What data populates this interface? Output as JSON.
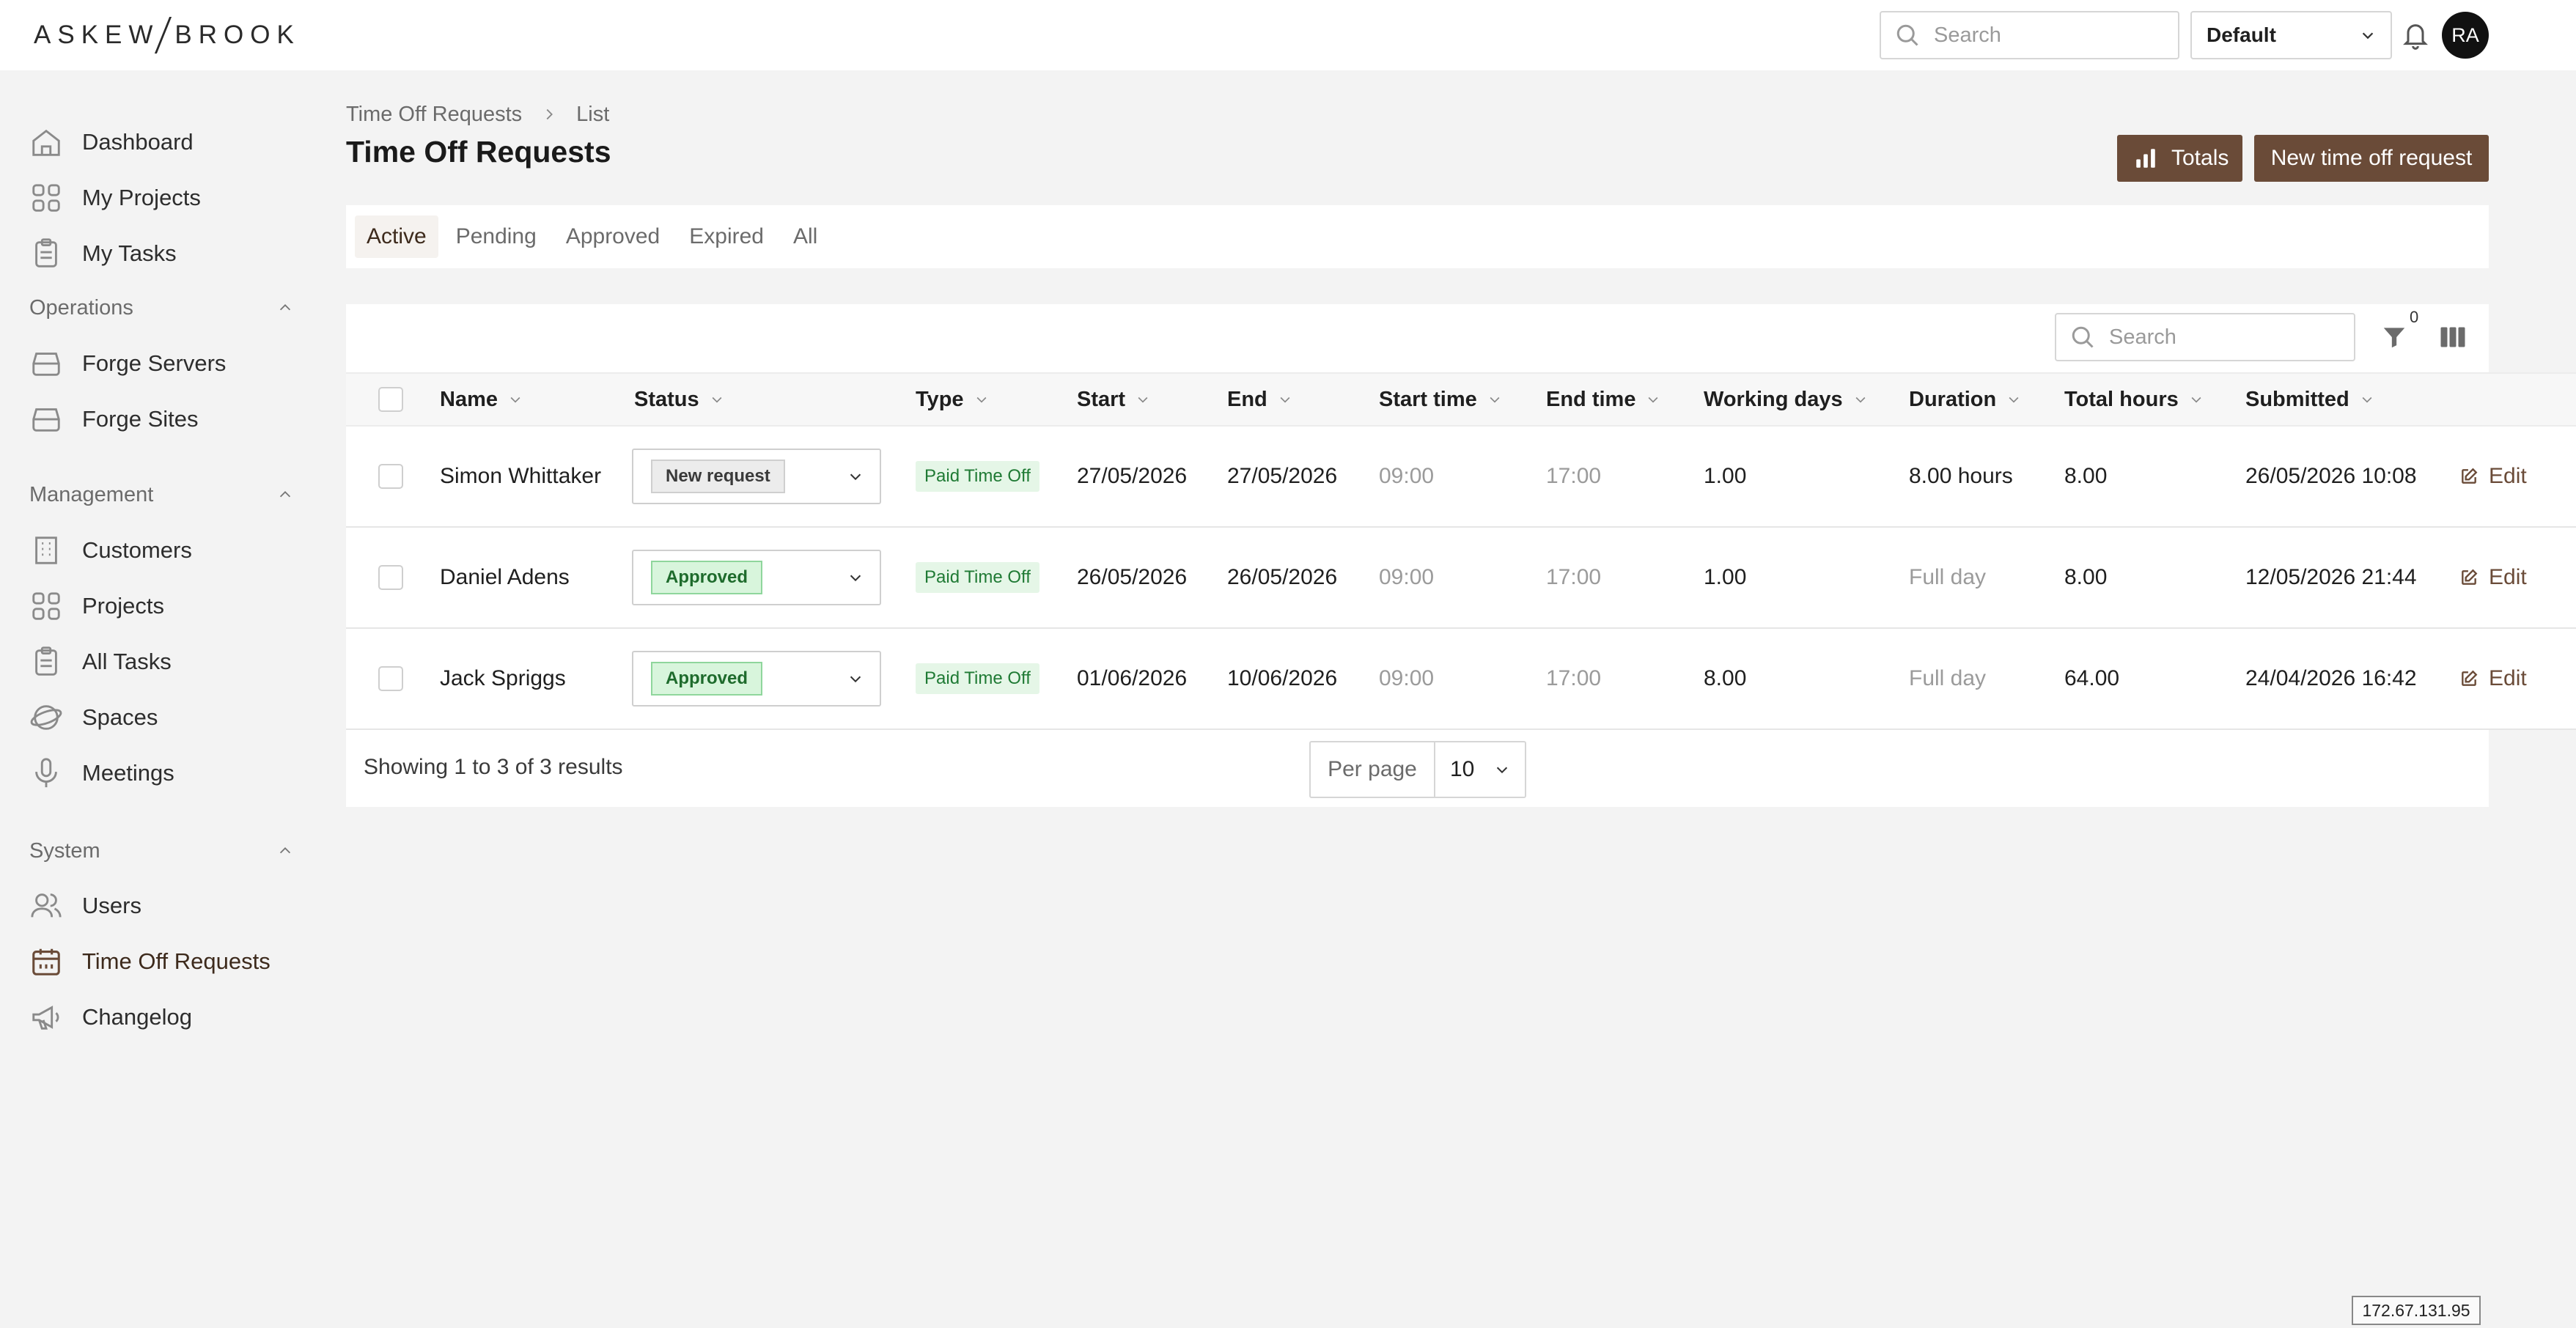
{
  "brand": {
    "left": "ASKEW",
    "right": "BROOK"
  },
  "topbar": {
    "search_placeholder": "Search",
    "workspace_select": "Default",
    "avatar_initials": "RA"
  },
  "sidebar": {
    "top_items": [
      {
        "label": "Dashboard",
        "icon": "home-icon"
      },
      {
        "label": "My Projects",
        "icon": "grid-icon"
      },
      {
        "label": "My Tasks",
        "icon": "clipboard-icon"
      }
    ],
    "sections": [
      {
        "title": "Operations",
        "items": [
          {
            "label": "Forge Servers",
            "icon": "server-icon"
          },
          {
            "label": "Forge Sites",
            "icon": "server-icon"
          }
        ]
      },
      {
        "title": "Management",
        "items": [
          {
            "label": "Customers",
            "icon": "building-icon"
          },
          {
            "label": "Projects",
            "icon": "grid-icon"
          },
          {
            "label": "All Tasks",
            "icon": "clipboard-icon"
          },
          {
            "label": "Spaces",
            "icon": "globe-icon"
          },
          {
            "label": "Meetings",
            "icon": "microphone-icon"
          }
        ]
      },
      {
        "title": "System",
        "items": [
          {
            "label": "Users",
            "icon": "users-icon"
          },
          {
            "label": "Time Off Requests",
            "icon": "calendar-icon"
          },
          {
            "label": "Changelog",
            "icon": "megaphone-icon"
          }
        ]
      }
    ]
  },
  "breadcrumb": {
    "parent": "Time Off Requests",
    "current": "List"
  },
  "page_title": "Time Off Requests",
  "actions": {
    "totals": "Totals",
    "new_request": "New time off request"
  },
  "tabs": [
    "Active",
    "Pending",
    "Approved",
    "Expired",
    "All"
  ],
  "active_tab": "Active",
  "table": {
    "search_placeholder": "Search",
    "filter_count": "0",
    "columns": [
      "Name",
      "Status",
      "Type",
      "Start",
      "End",
      "Start time",
      "End time",
      "Working days",
      "Duration",
      "Total hours",
      "Submitted"
    ],
    "rows": [
      {
        "name": "Simon Whittaker",
        "status": "New request",
        "type": "Paid Time Off",
        "start": "27/05/2026",
        "end": "27/05/2026",
        "start_time": "09:00",
        "end_time": "17:00",
        "working_days": "1.00",
        "duration": "8.00 hours",
        "total_hours": "8.00",
        "submitted": "26/05/2026 10:08",
        "action": "Edit"
      },
      {
        "name": "Daniel Adens",
        "status": "Approved",
        "type": "Paid Time Off",
        "start": "26/05/2026",
        "end": "26/05/2026",
        "start_time": "09:00",
        "end_time": "17:00",
        "working_days": "1.00",
        "duration": "Full day",
        "total_hours": "8.00",
        "submitted": "12/05/2026 21:44",
        "action": "Edit"
      },
      {
        "name": "Jack Spriggs",
        "status": "Approved",
        "type": "Paid Time Off",
        "start": "01/06/2026",
        "end": "10/06/2026",
        "start_time": "09:00",
        "end_time": "17:00",
        "working_days": "8.00",
        "duration": "Full day",
        "total_hours": "64.00",
        "submitted": "24/04/2026 16:42",
        "action": "Edit"
      }
    ],
    "summary": "Showing 1 to 3 of 3 results",
    "per_page_label": "Per page",
    "per_page_value": "10"
  },
  "ip_address": "172.67.131.95",
  "colors": {
    "accent": "#6a4b38",
    "approved": "#1e6b2c",
    "background": "#f3f3f3"
  }
}
